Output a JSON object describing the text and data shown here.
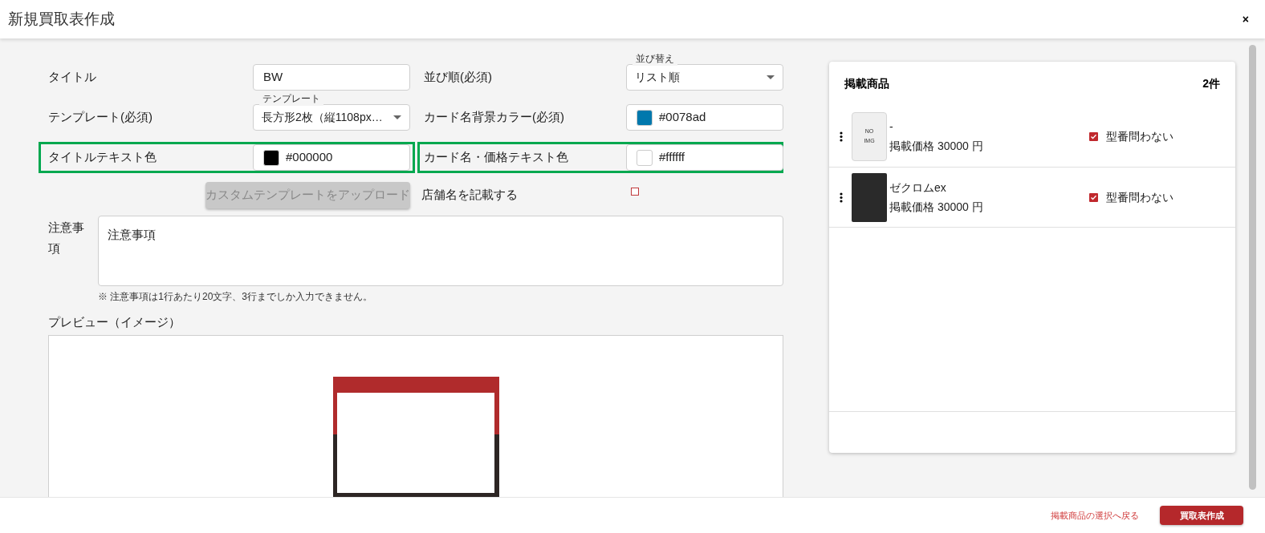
{
  "window": {
    "title": "新規買取表作成",
    "close": "×"
  },
  "form": {
    "rows": [
      {
        "left": {
          "kind": "text",
          "label": "タイトル",
          "value": "BW",
          "highlighted": false
        },
        "right": {
          "kind": "select",
          "label": "並び順(必須)",
          "floating_label": "並び替え",
          "value": "リスト順",
          "highlighted": false
        }
      },
      {
        "left": {
          "kind": "select",
          "label": "テンプレート(必須)",
          "floating_label": "テンプレート",
          "value": "長方形2枚（縦1108px…",
          "highlighted": false
        },
        "right": {
          "kind": "color",
          "label": "カード名背景カラー(必須)",
          "value": "#0078ad",
          "color": "#0078ad",
          "highlighted": false
        }
      },
      {
        "left": {
          "kind": "color",
          "label": "タイトルテキスト色",
          "value": "#000000",
          "color": "#000000",
          "highlighted": true
        },
        "right": {
          "kind": "color",
          "label": "カード名・価格テキスト色",
          "value": "#ffffff",
          "color": "#ffffff",
          "highlighted": true
        }
      }
    ],
    "upload_button": {
      "label": "カスタムテンプレートをアップロード",
      "disabled": true
    },
    "store_name": {
      "label": "店舗名を記載する",
      "checked": false
    },
    "notes": {
      "label": "注意事項",
      "value": "注意事項",
      "hint": "※ 注意事項は1行あたり20文字、3行までしか入力できません。"
    },
    "preview": {
      "label": "プレビュー（イメージ）"
    }
  },
  "products": {
    "title": "掲載商品",
    "count": "2件",
    "items": [
      {
        "kind": "no_image",
        "image_text": "NO IMG",
        "name": "-",
        "price": "掲載価格 30000 円",
        "any_model": {
          "label": "型番問わない",
          "checked": true
        }
      },
      {
        "kind": "photo",
        "name": "ゼクロムex",
        "price": "掲載価格 30000 円",
        "any_model": {
          "label": "型番問わない",
          "checked": true
        }
      }
    ]
  },
  "footer": {
    "back_link": "掲載商品の選択へ戻る",
    "submit": "買取表作成"
  }
}
